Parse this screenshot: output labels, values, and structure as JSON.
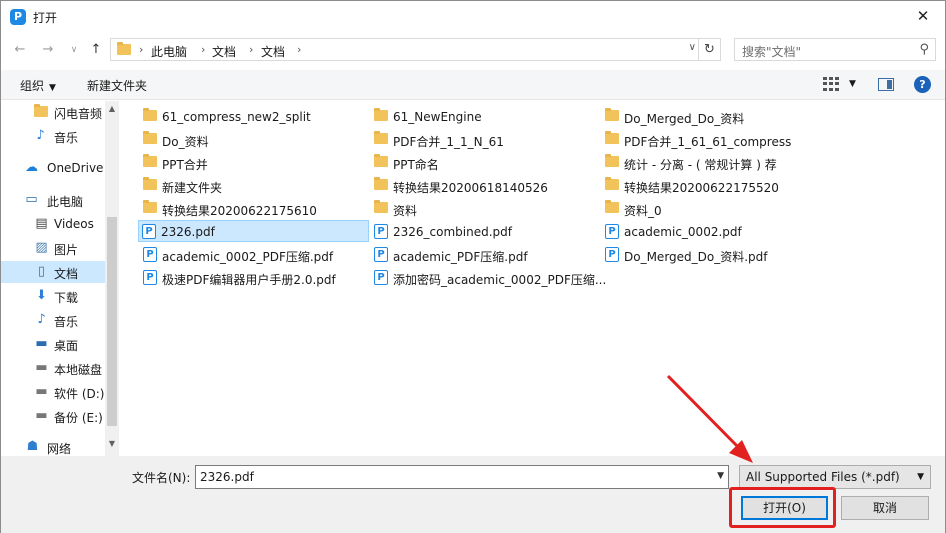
{
  "window": {
    "title": "打开",
    "app_icon": "P"
  },
  "nav": {
    "back_icon": "←",
    "forward_icon": "→",
    "dropdown_icon": "∨",
    "up_icon": "↑",
    "breadcrumb": [
      "此电脑",
      "文档",
      "文档"
    ],
    "separator": "›",
    "refresh_icon": "↻",
    "search_placeholder": "搜索\"文档\"",
    "search_icon": "⚲"
  },
  "toolbar": {
    "organize": "组织",
    "new_folder": "新建文件夹",
    "help": "?"
  },
  "sidebar": {
    "items": [
      {
        "label": "闪电音频",
        "icon": "folder"
      },
      {
        "label": "音乐",
        "icon": "music"
      },
      {
        "label": "OneDrive",
        "icon": "cloud"
      },
      {
        "label": "此电脑",
        "icon": "pc"
      },
      {
        "label": "Videos",
        "icon": "video"
      },
      {
        "label": "图片",
        "icon": "picture"
      },
      {
        "label": "文档",
        "icon": "document"
      },
      {
        "label": "下载",
        "icon": "download"
      },
      {
        "label": "音乐",
        "icon": "music"
      },
      {
        "label": "桌面",
        "icon": "desktop"
      },
      {
        "label": "本地磁盘",
        "icon": "drive"
      },
      {
        "label": "软件 (D:)",
        "icon": "drive"
      },
      {
        "label": "备份 (E:)",
        "icon": "drive"
      },
      {
        "label": "网络",
        "icon": "network"
      }
    ]
  },
  "files": {
    "col1": [
      {
        "name": "61_compress_new2_split",
        "type": "folder"
      },
      {
        "name": "Do_资料",
        "type": "folder"
      },
      {
        "name": "PPT合并",
        "type": "folder"
      },
      {
        "name": "新建文件夹",
        "type": "folder"
      },
      {
        "name": "转换结果20200622175610",
        "type": "folder"
      },
      {
        "name": "2326.pdf",
        "type": "pdf"
      },
      {
        "name": "academic_0002_PDF压缩.pdf",
        "type": "pdf"
      },
      {
        "name": "极速PDF编辑器用户手册2.0.pdf",
        "type": "pdf"
      }
    ],
    "col2": [
      {
        "name": "61_NewEngine",
        "type": "folder"
      },
      {
        "name": "PDF合并_1_1_N_61",
        "type": "folder"
      },
      {
        "name": "PPT命名",
        "type": "folder"
      },
      {
        "name": "转换结果20200618140526",
        "type": "folder"
      },
      {
        "name": "资料",
        "type": "folder"
      },
      {
        "name": "2326_combined.pdf",
        "type": "pdf"
      },
      {
        "name": "academic_PDF压缩.pdf",
        "type": "pdf"
      },
      {
        "name": "添加密码_academic_0002_PDF压缩...",
        "type": "pdf"
      }
    ],
    "col3": [
      {
        "name": "Do_Merged_Do_资料",
        "type": "folder"
      },
      {
        "name": "PDF合并_1_61_61_compress",
        "type": "folder"
      },
      {
        "name": "统计 - 分离 - ( 常规计算 ) 荐",
        "type": "folder"
      },
      {
        "name": "转换结果20200622175520",
        "type": "folder"
      },
      {
        "name": "资料_0",
        "type": "folder"
      },
      {
        "name": "academic_0002.pdf",
        "type": "pdf"
      },
      {
        "name": "Do_Merged_Do_资料.pdf",
        "type": "pdf"
      }
    ]
  },
  "bottom": {
    "filename_label": "文件名(N):",
    "filename_value": "2326.pdf",
    "filetype_value": "All Supported Files (*.pdf)",
    "open_button": "打开(O)",
    "cancel_button": "取消"
  },
  "colors": {
    "selection": "#cce8ff",
    "accent": "#0078d7",
    "annotation": "#e32020",
    "folder": "#f3c35b",
    "pdf": "#1e88e5"
  }
}
